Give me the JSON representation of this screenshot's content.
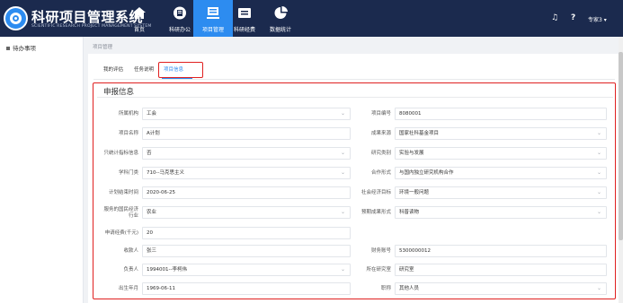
{
  "header": {
    "title": "科研项目管理系统",
    "subtitle": "SCIENTIFIC RESEARCH PROJECT MANAGEMENT SYSTEM",
    "nav": [
      {
        "label": "首页",
        "icon": "home-icon"
      },
      {
        "label": "科研办公",
        "icon": "office-icon"
      },
      {
        "label": "项目管理",
        "icon": "project-icon"
      },
      {
        "label": "科研经费",
        "icon": "funds-icon"
      },
      {
        "label": "数据统计",
        "icon": "chart-icon"
      }
    ],
    "user": "专家3 ▾"
  },
  "sidebar": {
    "items": [
      {
        "label": "待办事项"
      }
    ]
  },
  "breadcrumb": "项目管理",
  "tabs": [
    {
      "label": "我的评估"
    },
    {
      "label": "任务说明"
    },
    {
      "label": "项目信息"
    }
  ],
  "section": {
    "title": "申报信息"
  },
  "form": {
    "left": [
      {
        "label": "所属机构",
        "value": "工会",
        "select": true
      },
      {
        "label": "项目名称",
        "value": "A计划",
        "select": false
      },
      {
        "label": "只统计指标信息",
        "value": "否",
        "select": true
      },
      {
        "label": "学科门类",
        "value": "710--马克思主义",
        "select": true
      },
      {
        "label": "计划结束时间",
        "value": "2020-06-25",
        "select": false
      },
      {
        "label": "服务的国民经济\n行业",
        "value": "农业",
        "select": true
      },
      {
        "label": "申请经费(千元)",
        "value": "20",
        "select": false
      },
      {
        "label": "收款人",
        "value": "张三",
        "select": false
      },
      {
        "label": "负责人",
        "value": "1994001--李柯伟",
        "select": true
      },
      {
        "label": "出生年月",
        "value": "1969-06-11",
        "select": false
      }
    ],
    "right": [
      {
        "label": "项目编号",
        "value": "8080001",
        "select": false
      },
      {
        "label": "成果来源",
        "value": "国家社科基金项目",
        "select": true
      },
      {
        "label": "研究类别",
        "value": "实验与发展",
        "select": true
      },
      {
        "label": "合作形式",
        "value": "与国内独立研究机构合作",
        "select": true
      },
      {
        "label": "社会经济目标",
        "value": "环境一般问题",
        "select": true
      },
      {
        "label": "预期成果形式",
        "value": "科普读物",
        "select": true
      },
      {
        "label": "财务账号",
        "value": "5300000012",
        "select": false
      },
      {
        "label": "所在研究室",
        "value": "研究室",
        "select": false
      },
      {
        "label": "职称",
        "value": "其他人员",
        "select": true
      }
    ]
  },
  "colors": {
    "header_bg": "#1b2a4e",
    "accent": "#2d8cf0",
    "highlight": "#e02020"
  }
}
